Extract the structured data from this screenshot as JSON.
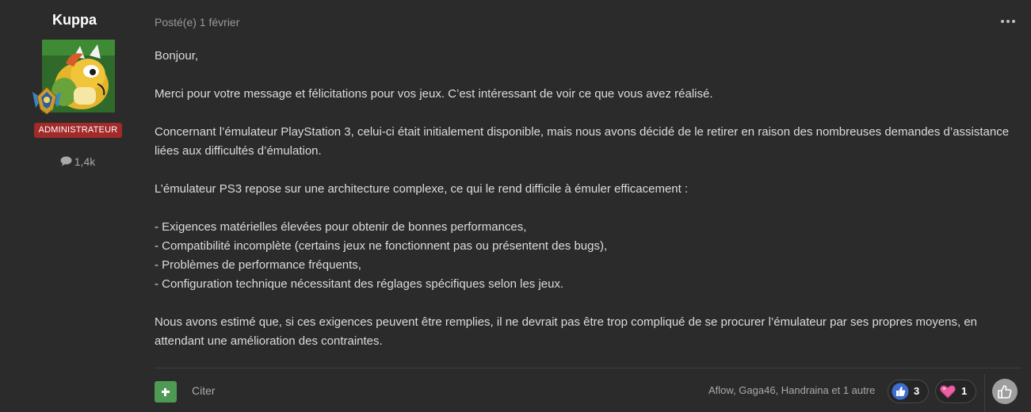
{
  "author": {
    "name": "Kuppa",
    "role": "ADMINISTRATEUR",
    "post_count": "1,4k",
    "post_count_icon": "comment-icon",
    "avatar_icon": "bowser-avatar"
  },
  "post": {
    "date": "Posté(e) 1 février",
    "paragraphs": [
      "Bonjour,",
      "",
      "Merci pour votre message et félicitations pour vos jeux. C’est intéressant de voir ce que vous avez réalisé.",
      "",
      "Concernant l’émulateur PlayStation 3, celui-ci était initialement disponible, mais nous avons décidé de le retirer en raison des nombreuses demandes d’assistance liées aux difficultés d’émulation.",
      "",
      "L’émulateur PS3 repose sur une architecture complexe, ce qui le rend difficile à émuler efficacement :",
      "",
      "- Exigences matérielles élevées pour obtenir de bonnes performances,",
      "- Compatibilité incomplète (certains jeux ne fonctionnent pas ou présentent des bugs),",
      "- Problèmes de performance fréquents,",
      "- Configuration technique nécessitant des réglages spécifiques selon les jeux.",
      "",
      "Nous avons estimé que, si ces exigences peuvent être remplies, il ne devrait pas être trop compliqué de se procurer l’émulateur par ses propres moyens, en attendant une amélioration des contraintes."
    ]
  },
  "footer": {
    "quote_label": "Citer",
    "reactors_text": "Aflow, Gaga46, Handraina et 1 autre",
    "reactions": [
      {
        "icon": "thumbs-up-icon",
        "count": "3"
      },
      {
        "icon": "heart-icon",
        "count": "1"
      }
    ],
    "react_icon": "thumbs-up-outline-icon"
  },
  "colors": {
    "background": "#2b2b2b",
    "role_badge": "#a22a2a",
    "plus_button": "#4e9a54"
  }
}
